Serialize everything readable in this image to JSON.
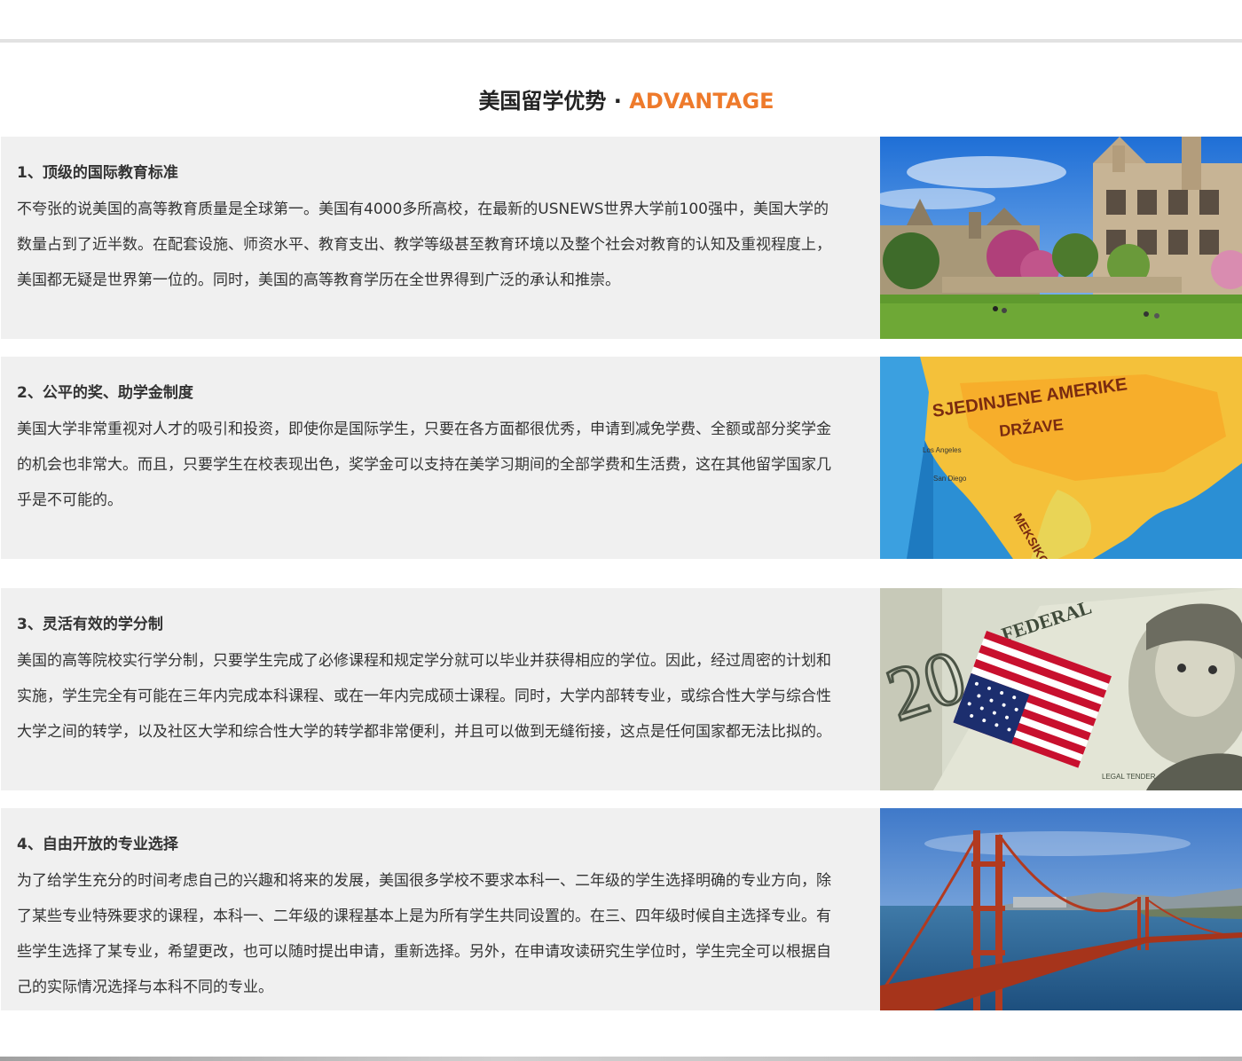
{
  "section": {
    "title_cn": "美国留学优势",
    "separator": "·",
    "title_en": "ADVANTAGE"
  },
  "colors": {
    "accent": "#ee7a2b",
    "card_bg": "#f0f0f0",
    "text": "#333333"
  },
  "advantages": [
    {
      "heading": "1、顶级的国际教育标准",
      "body": "不夸张的说美国的高等教育质量是全球第一。美国有4000多所高校，在最新的USNEWS世界大学前100强中，美国大学的数量占到了近半数。在配套设施、师资水平、教育支出、教学等级甚至教育环境以及整个社会对教育的认知及重视程度上，美国都无疑是世界第一位的。同时，美国的高等教育学历在全世界得到广泛的承认和推崇。",
      "image": "university-campus-photo"
    },
    {
      "heading": "2、公平的奖、助学金制度",
      "body": "美国大学非常重视对人才的吸引和投资，即使你是国际学生，只要在各方面都很优秀，申请到减免学费、全额或部分奖学金的机会也非常大。而且，只要学生在校表现出色，奖学金可以支持在美学习期间的全部学费和生活费，这在其他留学国家几乎是不可能的。",
      "image": "north-america-globe-photo",
      "map_labels": [
        "SJEDINJENE AMERIKE",
        "DRŽAVE",
        "MEKSIKO",
        "Los Angeles",
        "San Diego"
      ]
    },
    {
      "heading": "3、灵活有效的学分制",
      "body": "美国的高等院校实行学分制，只要学生完成了必修课程和规定学分就可以毕业并获得相应的学位。因此，经过周密的计划和实施，学生完全有可能在三年内完成本科课程、或在一年内完成硕士课程。同时，大学内部转专业，或综合性大学与综合性大学之间的转学，以及社区大学和综合性大学的转学都非常便利，并且可以做到无缝衔接，这点是任何国家都无法比拟的。",
      "image": "us-flag-dollar-photo",
      "bill_labels": [
        "FEDERAL",
        "20",
        "LEGAL TENDER"
      ]
    },
    {
      "heading": "4、自由开放的专业选择",
      "body": "为了给学生充分的时间考虑自己的兴趣和将来的发展，美国很多学校不要求本科一、二年级的学生选择明确的专业方向，除了某些专业特殊要求的课程，本科一、二年级的课程基本上是为所有学生共同设置的。在三、四年级时候自主选择专业。有些学生选择了某专业，希望更改，也可以随时提出申请，重新选择。另外，在申请攻读研究生学位时，学生完全可以根据自己的实际情况选择与本科不同的专业。",
      "image": "golden-gate-bridge-photo"
    }
  ]
}
